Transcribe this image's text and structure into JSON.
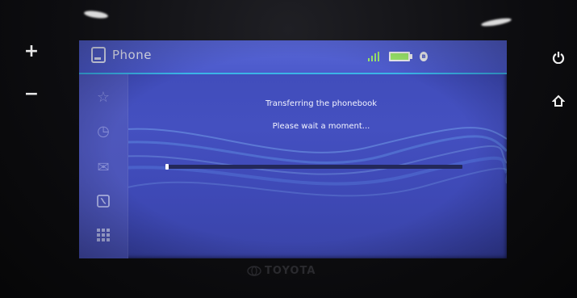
{
  "app": {
    "title": "Phone"
  },
  "status_bar": {
    "signal_icon": "signal-bars-icon",
    "battery_icon": "battery-icon",
    "bluetooth_icon": "bluetooth-icon",
    "signal_color": "#9ce86a"
  },
  "sidebar": {
    "items": [
      {
        "icon": "star-icon"
      },
      {
        "icon": "history-icon"
      },
      {
        "icon": "message-icon"
      },
      {
        "icon": "contacts-icon"
      },
      {
        "icon": "keypad-icon"
      }
    ]
  },
  "dialog": {
    "line1": "Transferring the phonebook",
    "line2": "Please wait a moment..."
  },
  "progress": {
    "fraction": 0.01
  },
  "hardware": {
    "volume_up": "+",
    "volume_down": "−",
    "brand": "TOYOTA"
  },
  "colors": {
    "screen_bg": "#4450c0",
    "accent_line": "#3bb3e6"
  }
}
